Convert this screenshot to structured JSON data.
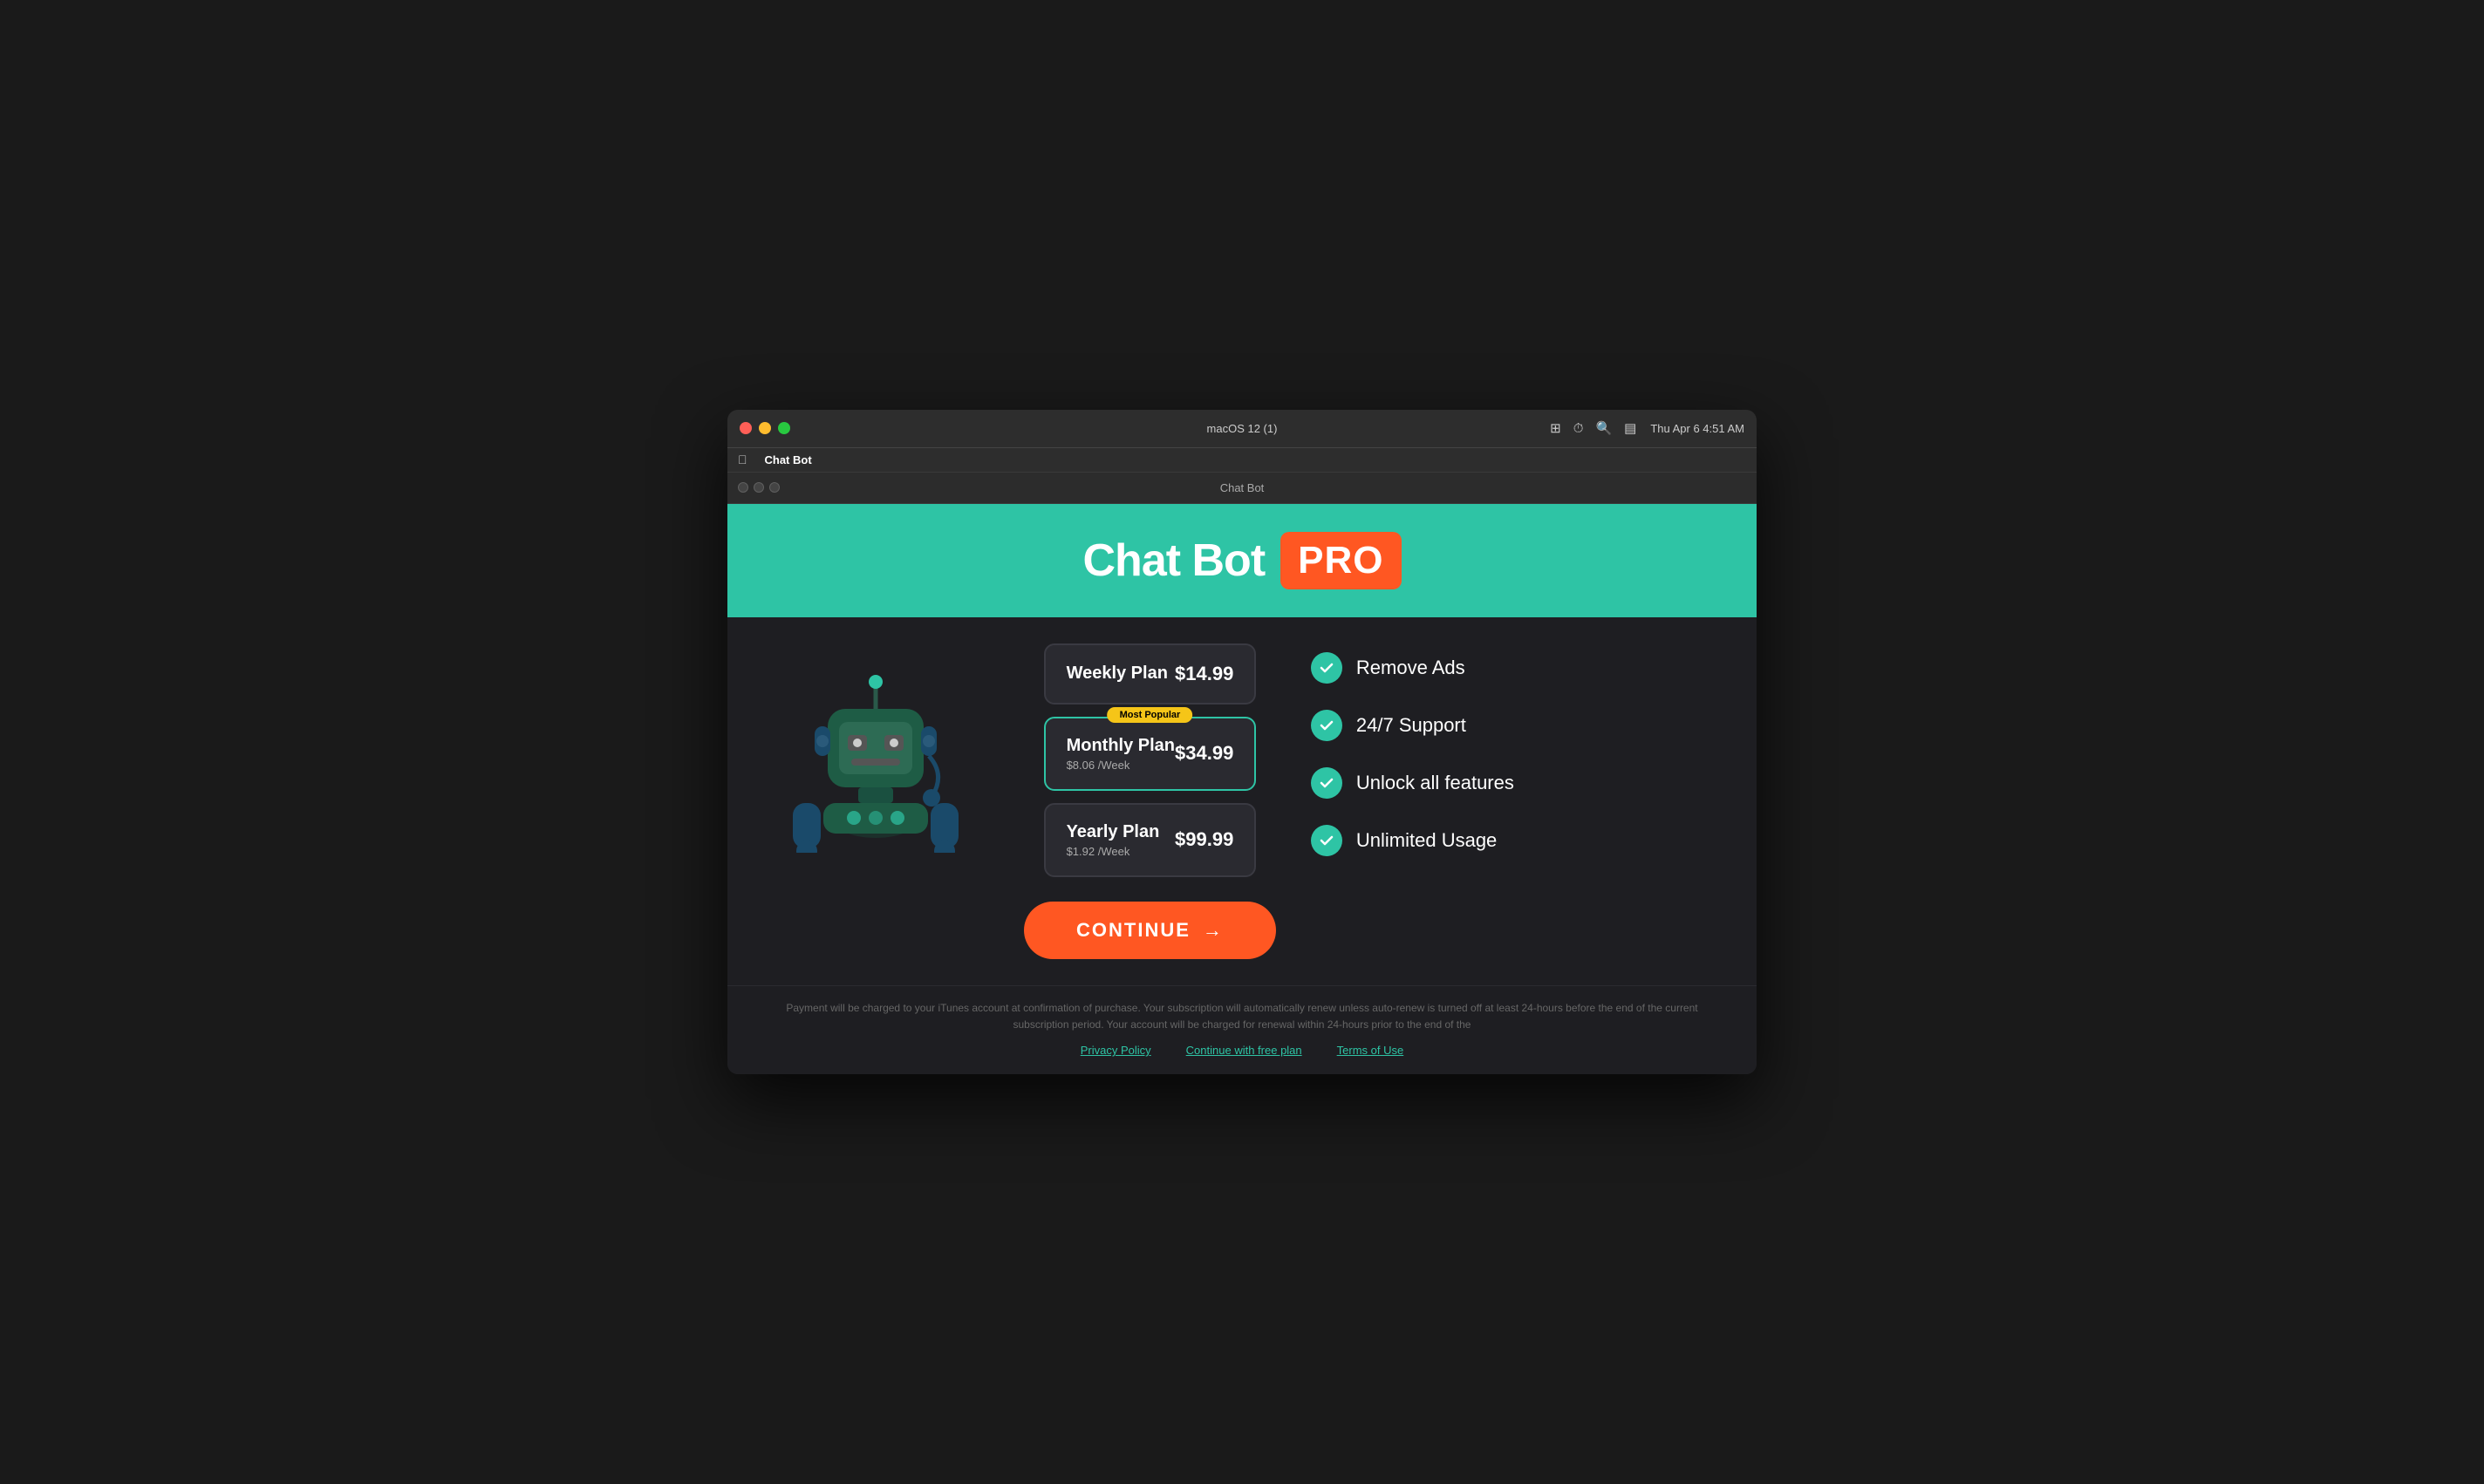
{
  "os": {
    "title": "macOS 12 (1)",
    "app_name": "Chat Bot",
    "time": "Thu Apr 6  4:51 AM"
  },
  "inner_window": {
    "title": "Chat Bot"
  },
  "hero": {
    "app_title": "Chat Bot",
    "pro_badge": "PRO"
  },
  "plans": [
    {
      "name": "Weekly Plan",
      "price": "$14.99",
      "sub": "",
      "popular": false,
      "selected": false,
      "id": "weekly"
    },
    {
      "name": "Monthly Plan",
      "price": "$34.99",
      "sub": "$8.06 /Week",
      "popular": true,
      "popular_label": "Most Popular",
      "selected": true,
      "id": "monthly"
    },
    {
      "name": "Yearly Plan",
      "price": "$99.99",
      "sub": "$1.92 /Week",
      "popular": false,
      "selected": false,
      "id": "yearly"
    }
  ],
  "continue_button": {
    "label": "CONTINUE",
    "arrow": "→"
  },
  "features": [
    {
      "label": "Remove Ads"
    },
    {
      "label": "24/7 Support"
    },
    {
      "label": "Unlock all features"
    },
    {
      "label": "Unlimited Usage"
    }
  ],
  "footer": {
    "text": "Payment will be charged to your iTunes account at confirmation of purchase. Your subscription will automatically renew unless auto-renew is turned off at least 24-hours before the end of the current subscription period. Your account will be charged for renewal within 24-hours prior to the end of the",
    "links": [
      {
        "label": "Privacy Policy",
        "id": "privacy"
      },
      {
        "label": "Continue with free plan",
        "id": "free-plan"
      },
      {
        "label": "Terms of Use",
        "id": "terms"
      }
    ]
  }
}
